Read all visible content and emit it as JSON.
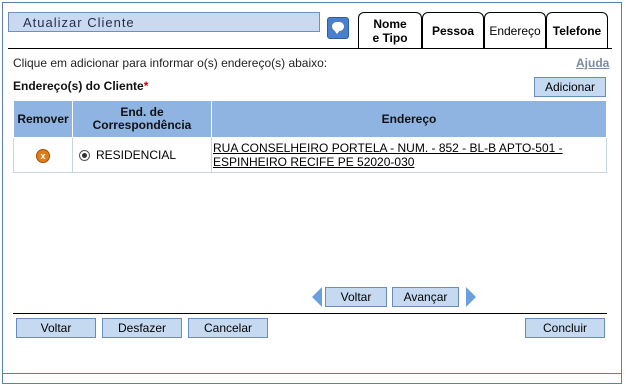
{
  "window": {
    "title": "Atualizar Cliente"
  },
  "tabs": [
    {
      "label": "Nome e Tipo",
      "line1": "Nome",
      "line2": "e Tipo"
    },
    {
      "label": "Pessoa"
    },
    {
      "label": "Endereço"
    },
    {
      "label": "Telefone"
    }
  ],
  "active_tab": "Endereço",
  "info_text": "Clique em adicionar para informar o(s) endereço(s) abaixo:",
  "help_link": "Ajuda",
  "section": {
    "label": "Endereço(s) do Cliente",
    "required_mark": "*"
  },
  "add_button": "Adicionar",
  "table": {
    "headers": {
      "remove": "Remover",
      "corr_line1": "End. de",
      "corr_line2": "Correspondência",
      "address": "Endereço"
    },
    "rows": [
      {
        "remove_icon": "remove-icon",
        "type": "RESIDENCIAL",
        "selected": true,
        "address_line1": "RUA CONSELHEIRO PORTELA - NUM. - 852 - BL-B APTO-501 -",
        "address_line2": "ESPINHEIRO RECIFE PE 52020-030"
      }
    ]
  },
  "pager": {
    "back": "Voltar",
    "next": "Avançar"
  },
  "footer_buttons": {
    "back": "Voltar",
    "undo": "Desfazer",
    "cancel": "Cancelar",
    "finish": "Concluir"
  },
  "colors": {
    "header_bg": "#8fb4e2",
    "button_bg": "#c5d9f1",
    "title_bg": "#c9d9ef",
    "required": "#cc0000",
    "remove_icon": "#e07d18"
  }
}
